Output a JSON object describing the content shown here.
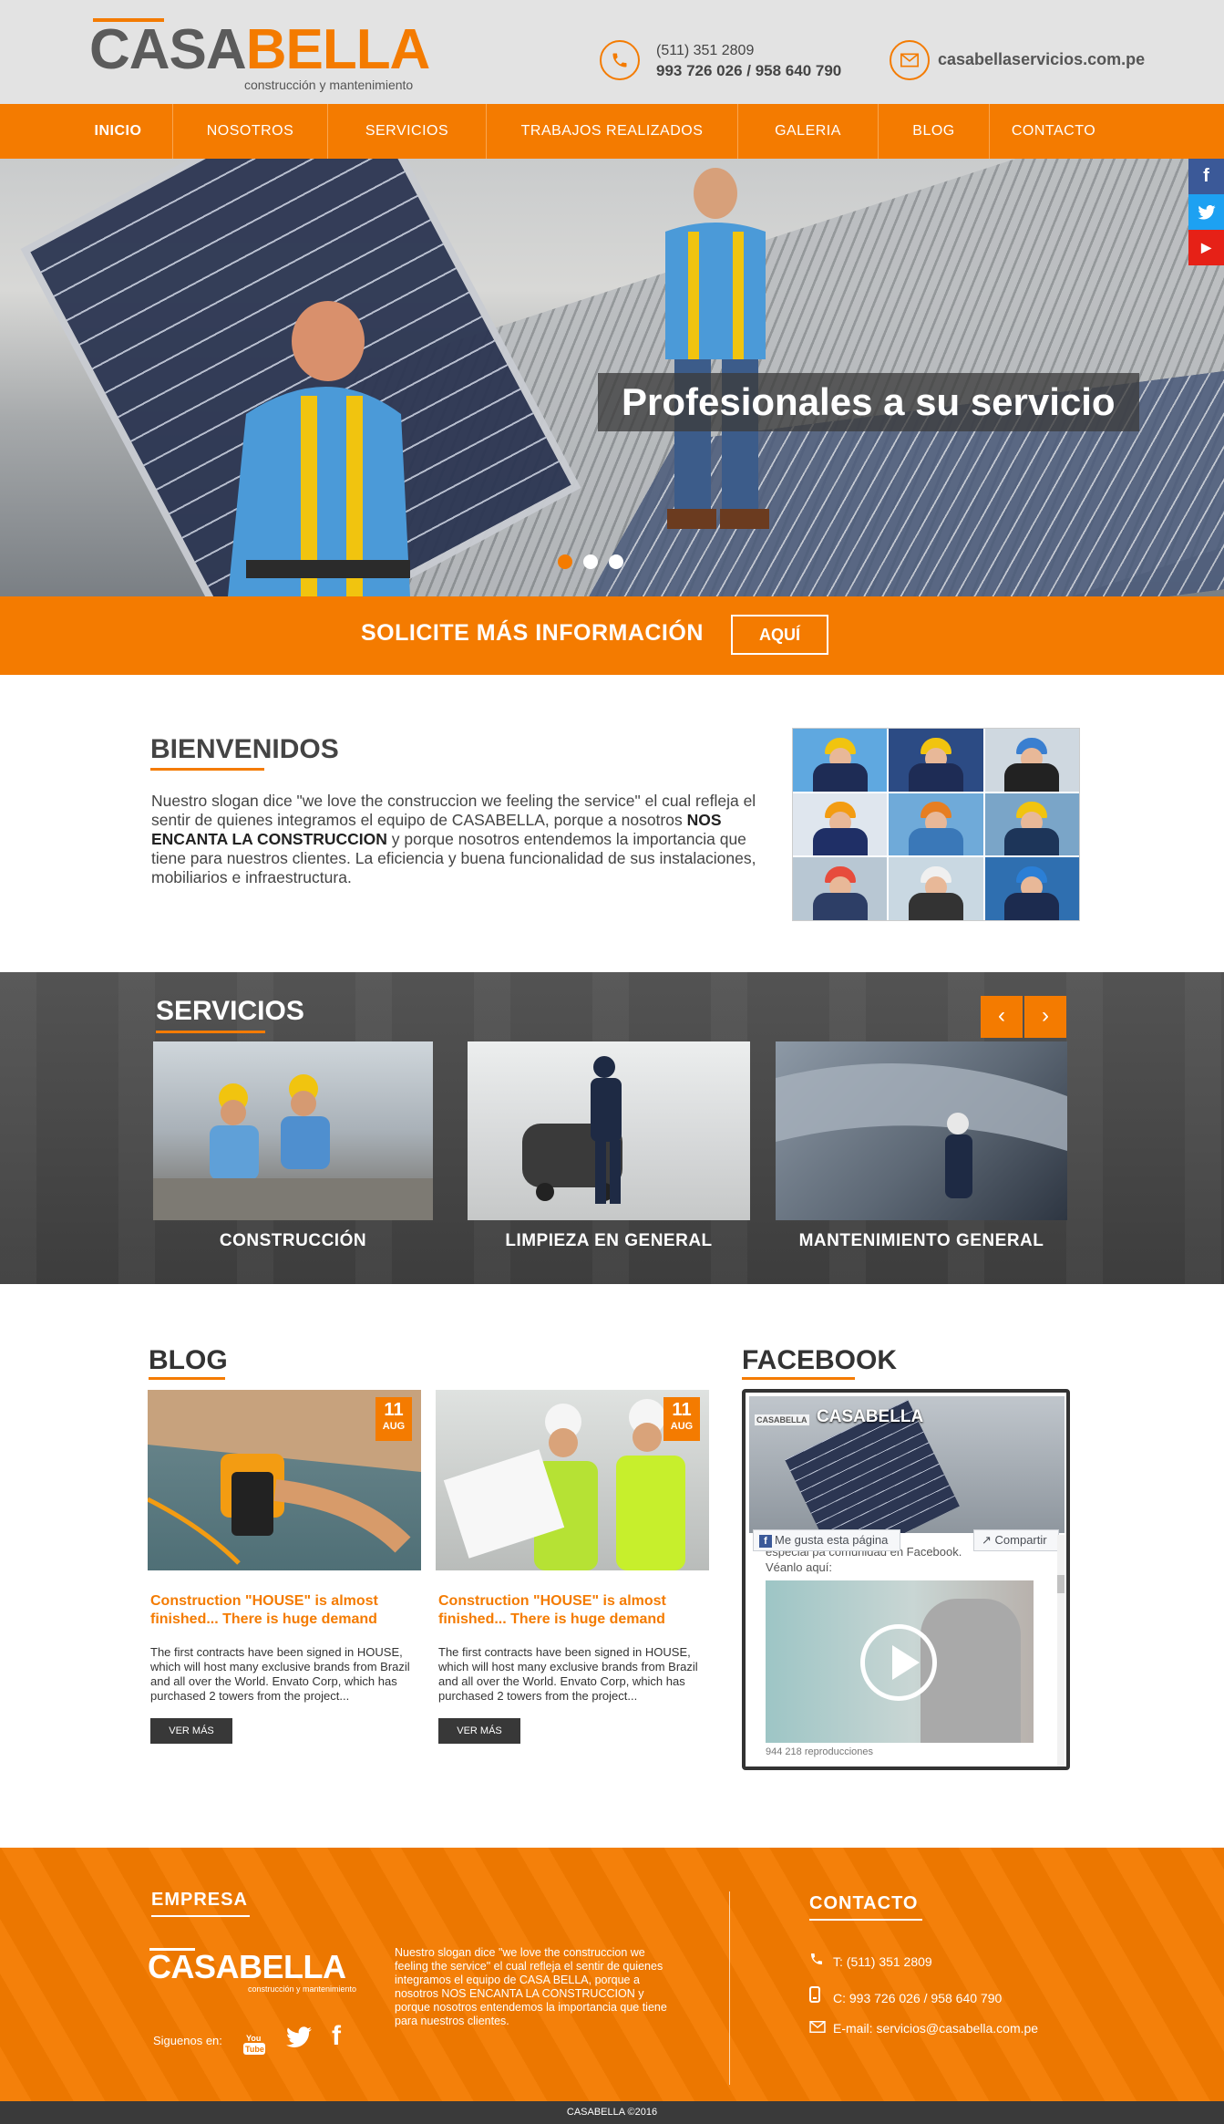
{
  "brand": {
    "name_part1": "CASA",
    "name_part2": "BELLA",
    "tagline": "construcción y mantenimiento",
    "accent_color": "#f47b00"
  },
  "header": {
    "phone_icon": "phone-icon",
    "phone_line1": "(511) 351 2809",
    "phone_line2": "993 726 026 / 958 640 790",
    "mail_icon": "mail-icon",
    "website": "casabellaservicios.com.pe"
  },
  "nav": {
    "items": [
      "INICIO",
      "NOSOTROS",
      "SERVICIOS",
      "TRABAJOS REALIZADOS",
      "GALERIA",
      "BLOG",
      "CONTACTO"
    ],
    "active": "INICIO"
  },
  "hero": {
    "caption": "Profesionales a su servicio",
    "slide_count": 3,
    "active_slide": 1
  },
  "social_side": {
    "facebook": "f",
    "twitter": "t",
    "youtube": "▶"
  },
  "cta": {
    "text": "SOLICITE MÁS INFORMACIÓN",
    "button": "AQUÍ"
  },
  "welcome": {
    "title": "BIENVENIDOS",
    "text_before": "Nuestro slogan dice \"we love the construccion we feeling the service\" el cual refleja el sentir de quienes integramos el equipo de CASABELLA, porque a nosotros ",
    "text_bold": "NOS ENCANTA LA CONSTRUCCION",
    "text_after": " y porque nosotros entendemos la importancia que tiene para nuestros clientes. La eficiencia y buena funcionalidad de sus instalaciones, mobiliarios e infraestructura."
  },
  "services": {
    "title": "SERVICIOS",
    "prev": "‹",
    "next": "›",
    "items": [
      {
        "label": "CONSTRUCCIÓN"
      },
      {
        "label": "LIMPIEZA EN GENERAL"
      },
      {
        "label": "MANTENIMIENTO GENERAL"
      }
    ]
  },
  "blog": {
    "title": "BLOG",
    "posts": [
      {
        "day": "11",
        "month": "AUG",
        "title": "Construction \"HOUSE\" is almost finished... There is huge demand",
        "excerpt": "The first contracts have been signed in HOUSE, which will host many exclusive brands from Brazil and all over the World. Envato Corp, which has purchased 2 towers from the project...",
        "button": "VER MÁS"
      },
      {
        "day": "11",
        "month": "AUG",
        "title": "Construction \"HOUSE\" is almost finished... There is huge demand",
        "excerpt": "The first contracts have been signed in HOUSE, which will host many exclusive brands from Brazil and all over the World. Envato Corp, which has purchased 2 towers from the project...",
        "button": "VER MÁS"
      }
    ]
  },
  "facebook": {
    "title": "FACEBOOK",
    "page_name": "CASABELLA",
    "mini_logo": "CASABELLA",
    "like_label": "Me gusta esta página",
    "share_label": "Compartir",
    "post_text": "especial pa comunidad en Facebook. Véanlo aquí:",
    "views": "944 218 reproducciones"
  },
  "footer": {
    "company_heading": "EMPRESA",
    "logo_name": "CASABELLA",
    "logo_tagline": "construcción y mantenimiento",
    "about": "Nuestro slogan dice \"we love the construccion we feeling the service\" el cual refleja el sentir de quienes integramos el equipo de CASA BELLA, porque a nosotros NOS ENCANTA LA CONSTRUCCION y porque nosotros entendemos la importancia que tiene para nuestros clientes.",
    "follow_label": "Siguenos en:",
    "contact_heading": "CONTACTO",
    "phone": "T: (511) 351 2809",
    "cell": "C: 993 726 026 / 958 640 790",
    "email": "E-mail: servicios@casabella.com.pe",
    "copyright": "CASABELLA ©2016"
  }
}
